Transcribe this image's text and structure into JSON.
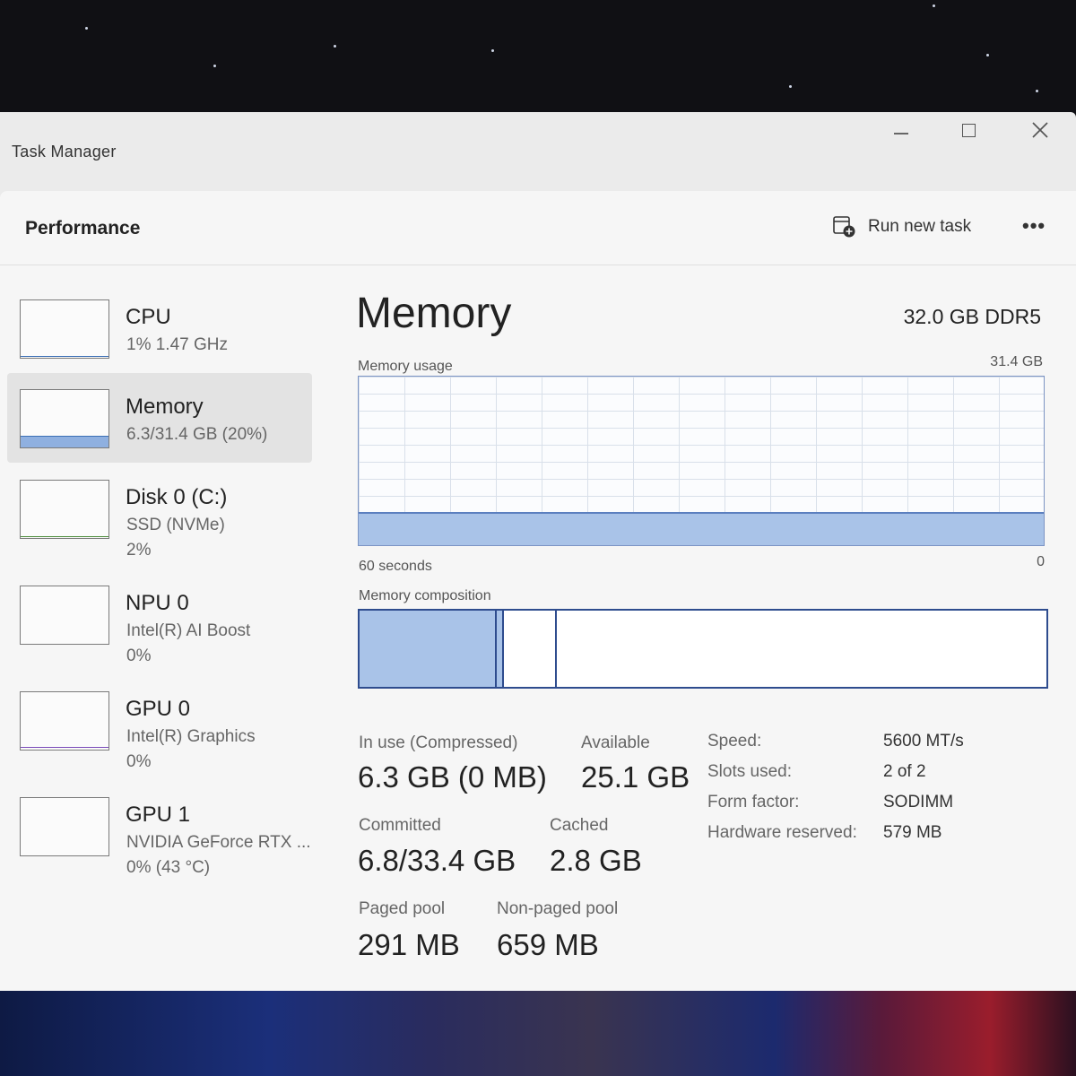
{
  "window": {
    "title": "Task Manager",
    "controls": {
      "minimize": "minimize",
      "maximize": "maximize",
      "close": "close"
    }
  },
  "header": {
    "title": "Performance",
    "run_new_task_label": "Run new task",
    "more_label": "•••"
  },
  "sidebar": {
    "items": [
      {
        "name": "CPU",
        "line1": "1%  1.47 GHz",
        "line2": "",
        "graph_level": 0.02,
        "graph_color": "#3c6fb5"
      },
      {
        "name": "Memory",
        "line1": "6.3/31.4 GB (20%)",
        "line2": "",
        "graph_level": 0.2,
        "graph_color": "#3c6fb5",
        "selected": true
      },
      {
        "name": "Disk 0 (C:)",
        "line1": "SSD (NVMe)",
        "line2": "2%",
        "graph_level": 0.02,
        "graph_color": "#4a8a3a"
      },
      {
        "name": "NPU 0",
        "line1": "Intel(R) AI Boost",
        "line2": "0%",
        "graph_level": 0,
        "graph_color": "#3c6fb5"
      },
      {
        "name": "GPU 0",
        "line1": "Intel(R) Graphics",
        "line2": "0%",
        "graph_level": 0.05,
        "graph_color": "#7a4ab8"
      },
      {
        "name": "GPU 1",
        "line1": "NVIDIA GeForce RTX ...",
        "line2": "0%  (43 °C)",
        "graph_level": 0,
        "graph_color": "#7a4ab8"
      }
    ]
  },
  "main": {
    "title": "Memory",
    "spec": "32.0 GB DDR5",
    "usage_graph": {
      "label": "Memory usage",
      "max_label": "31.4 GB",
      "time_label": "60 seconds",
      "min_label": "0",
      "usage_fraction": 0.2
    },
    "composition": {
      "label": "Memory composition",
      "in_use_fraction": 0.2,
      "modified_fraction": 0.01,
      "standby_fraction": 0.077
    },
    "stats": {
      "in_use_label": "In use (Compressed)",
      "in_use_value": "6.3 GB (0 MB)",
      "available_label": "Available",
      "available_value": "25.1 GB",
      "committed_label": "Committed",
      "committed_value": "6.8/33.4 GB",
      "cached_label": "Cached",
      "cached_value": "2.8 GB",
      "paged_label": "Paged pool",
      "paged_value": "291 MB",
      "nonpaged_label": "Non-paged pool",
      "nonpaged_value": "659 MB"
    },
    "specs": {
      "speed_label": "Speed:",
      "speed_value": "5600 MT/s",
      "slots_label": "Slots used:",
      "slots_value": "2 of 2",
      "form_label": "Form factor:",
      "form_value": "SODIMM",
      "reserved_label": "Hardware reserved:",
      "reserved_value": "579 MB"
    }
  },
  "colors": {
    "accent": "#2e4c8e",
    "fill": "#a9c3e8",
    "window_bg": "#f6f6f6"
  }
}
